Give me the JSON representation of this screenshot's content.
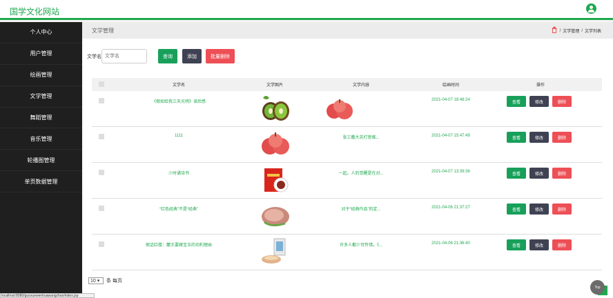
{
  "brand": "国学文化网站",
  "sidebar": {
    "items": [
      {
        "label": "个人中心"
      },
      {
        "label": "用户管理"
      },
      {
        "label": "绘画管理"
      },
      {
        "label": "文学管理"
      },
      {
        "label": "舞蹈管理"
      },
      {
        "label": "音乐管理"
      },
      {
        "label": "轮播图管理"
      },
      {
        "label": "单页数据管理"
      }
    ]
  },
  "page": {
    "title": "文学管理",
    "breadcrumb": [
      "文学管理",
      "文学列表"
    ]
  },
  "search": {
    "label": "文学名",
    "placeholder": "文学名",
    "query_label": "查询",
    "add_label": "添加",
    "batch_delete_label": "批量删除"
  },
  "table": {
    "headers": [
      "文学名",
      "文学图片",
      "文学内容",
      "绘画时间",
      "操作"
    ],
    "rows": [
      {
        "name": "《假如给我三天光明》读后感",
        "content": "",
        "time": "2021-04-07 18:48:24",
        "image": "kiwi",
        "content_image": "apples"
      },
      {
        "name": "1111",
        "content": "张三撒大苏打思维...",
        "time": "2021-04-07 15:47:49",
        "image": "apples",
        "content_image": ""
      },
      {
        "name": "少时诵诗书",
        "content": "一起。人的觉醒是在对...",
        "time": "2021-04-07 13:39:36",
        "image": "red-pack",
        "content_image": ""
      },
      {
        "name": "“红色经典”不是“经典”",
        "content": "对于“经典作品”的定...",
        "time": "2021-04-06 21:37:27",
        "image": "meat",
        "content_image": ""
      },
      {
        "name": "假话红楼：麓王要嫁宝玉的功利理由",
        "content": "许多人都少可怜惜。《...",
        "time": "2021-04-06 21:36:40",
        "image": "package",
        "content_image": ""
      }
    ],
    "view_label": "查看",
    "edit_label": "修改",
    "delete_label": "删除"
  },
  "pager": {
    "page_size": "10",
    "suffix": "条 每页"
  },
  "top_label": "Top",
  "status_url": "localhost:8080/guoxuewenhuawangzhan/index.jsp"
}
